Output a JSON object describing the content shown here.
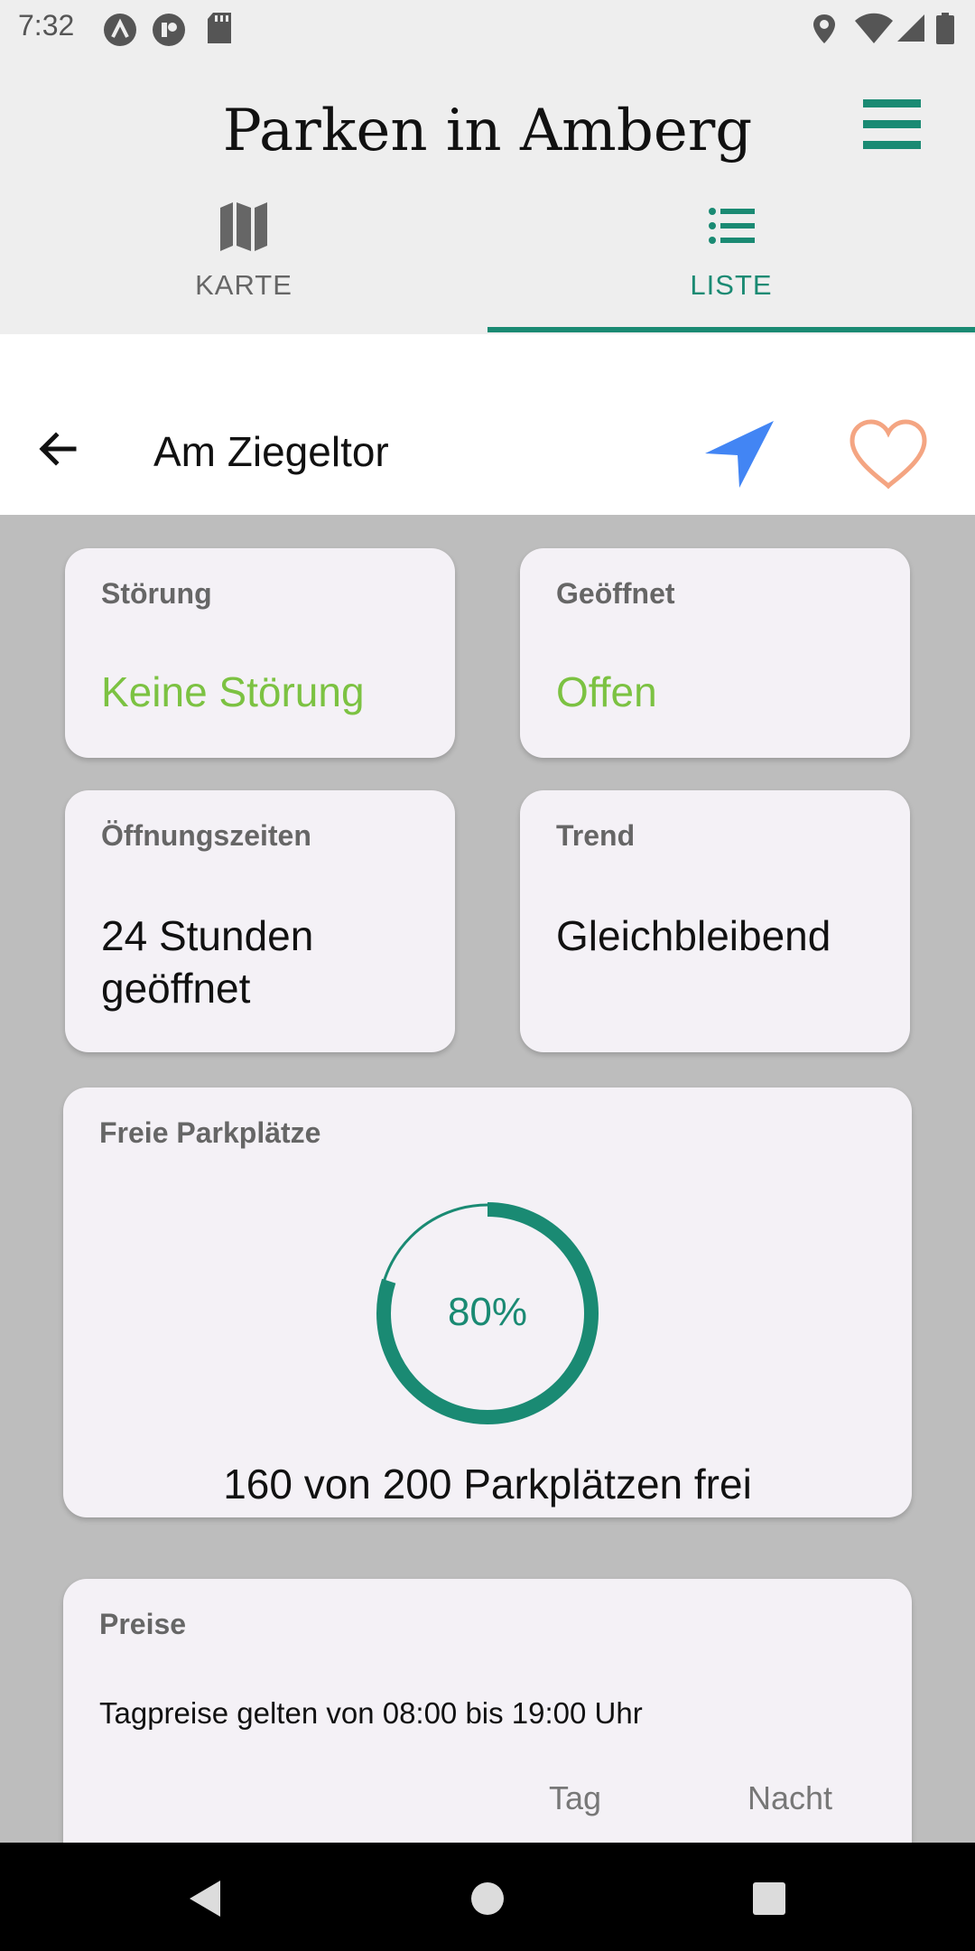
{
  "status_bar": {
    "time": "7:32",
    "left_icons": [
      "a-badge-icon",
      "chat-badge-icon",
      "sd-card-icon"
    ],
    "right_icons": [
      "location-icon",
      "wifi-icon",
      "signal-icon",
      "battery-icon"
    ]
  },
  "header": {
    "title": "Parken in Amberg",
    "menu_icon": "hamburger-menu-icon"
  },
  "tabs": [
    {
      "label": "KARTE",
      "icon": "map-icon",
      "active": false
    },
    {
      "label": "LISTE",
      "icon": "list-icon",
      "active": true
    }
  ],
  "detail": {
    "title": "Am Ziegeltor",
    "back_icon": "arrow-left-icon",
    "navigate_icon": "navigation-arrow-icon",
    "favorite_icon": "heart-outline-icon"
  },
  "cards": {
    "stoerung": {
      "label": "Störung",
      "value": "Keine Störung"
    },
    "geoeffnet": {
      "label": "Geöffnet",
      "value": "Offen"
    },
    "oeffnungszeiten": {
      "label": "Öffnungszeiten",
      "value": "24 Stunden geöffnet"
    },
    "trend": {
      "label": "Trend",
      "value": "Gleichbleibend"
    },
    "freie_parkplaetze": {
      "label": "Freie Parkplätze",
      "percent_text": "80%",
      "percent": 80,
      "free": 160,
      "total": 200,
      "summary": "160 von 200 Parkplätzen frei"
    },
    "preise": {
      "label": "Preise",
      "info": "Tagpreise gelten von 08:00 bis 19:00 Uhr",
      "columns": [
        "Tag",
        "Nacht"
      ]
    }
  },
  "colors": {
    "accent": "#1a8a73",
    "status_green": "#7cc242",
    "navigate_blue": "#4285f4",
    "favorite_orange": "#f4a582",
    "card_bg": "#f4f1f6",
    "content_bg": "#bdbdbd"
  },
  "nav_bar": [
    "back-triangle-icon",
    "home-circle-icon",
    "recents-square-icon"
  ]
}
